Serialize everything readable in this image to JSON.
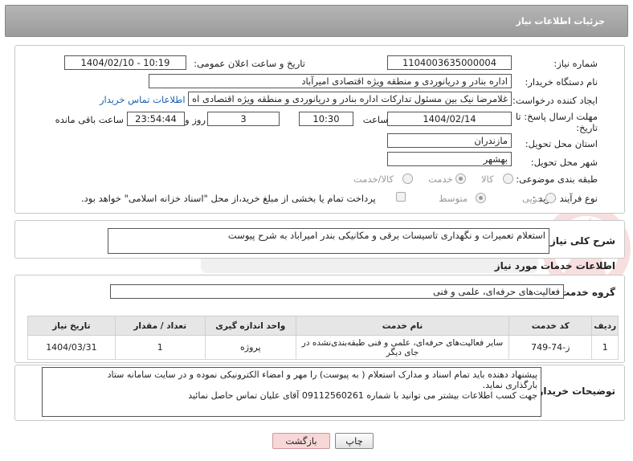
{
  "header": {
    "title": "جزئیات اطلاعات نیاز"
  },
  "form": {
    "need_number_label": "شماره نیاز:",
    "need_number": "1104003635000004",
    "announce_label": "تاریخ و ساعت اعلان عمومی:",
    "announce_value": "1404/02/10 - 10:19",
    "buyer_org_label": "نام دستگاه خریدار:",
    "buyer_org": "اداره بنادر و دریانوردی و منطقه ویژه اقتصادی امیرآباد",
    "creator_label": "ایجاد کننده درخواست:",
    "creator": "غلامرضا نیک بین مسئول تدارکات اداره بنادر و دریانوردی و منطقه ویژه اقتصادی اه",
    "contact_link": "اطلاعات تماس خریدار",
    "deadline_label_1": "مهلت ارسال پاسخ: تا",
    "deadline_label_2": "تاریخ:",
    "deadline_date": "1404/02/14",
    "time_label": "ساعت",
    "deadline_time": "10:30",
    "days_value": "3",
    "days_label": "روز و",
    "remaining_time": "23:54:44",
    "remaining_label": "ساعت باقی مانده",
    "province_label": "استان محل تحویل:",
    "province": "مازندران",
    "city_label": "شهر محل تحویل:",
    "city": "بهشهر",
    "category_label": "طبقه بندی موضوعی:",
    "category_options": [
      "کالا",
      "خدمت",
      "کالا/خدمت"
    ],
    "category_selected": "خدمت",
    "process_label": "نوع فرآیند خرید :",
    "process_options": [
      "جزیی",
      "متوسط"
    ],
    "process_selected": "متوسط",
    "payment_note": "پرداخت تمام یا بخشی از مبلغ خرید،از محل \"اسناد خزانه اسلامی\" خواهد بود."
  },
  "summary": {
    "label": "شرح کلی نیاز:",
    "text": "استعلام تعمیرات و نگهداری تاسیسات برقی و مکانیکی بندر امیراباد به شرح پیوست"
  },
  "services": {
    "section_title": "اطلاعات خدمات مورد نیاز",
    "group_label": "گروه خدمت:",
    "group_value": "فعالیت‌های حرفه‌ای، علمی و فنی",
    "columns": [
      "ردیف",
      "کد خدمت",
      "نام خدمت",
      "واحد اندازه گیری",
      "تعداد / مقدار",
      "تاریخ نیاز"
    ],
    "rows": [
      {
        "row": "1",
        "code": "ز-74-749",
        "name": "سایر فعالیت‌های حرفه‌ای، علمی و فنی طبقه‌بندی‌نشده در جای دیگر",
        "unit": "پروژه",
        "qty": "1",
        "date": "1404/03/31"
      }
    ]
  },
  "buyer_notes": {
    "label": "توضیحات خریدار:",
    "line1": "پیشنهاد دهنده باید تمام اسناد و مدارک استعلام ( به پیوست) را مهر و امضاء الکترونیکی نموده و در سایت سامانه ستاد",
    "line2": "بارگذاری نماید.",
    "line3": "جهت کسب اطلاعات بیشتر می توانید با شماره 09112560261 آقای علیان تماس حاصل نمائید"
  },
  "buttons": {
    "print": "چاپ",
    "back": "بازگشت"
  },
  "colors": {
    "header_gray": "#a8a8a8",
    "link_blue": "#1a5fb4",
    "back_button_bg": "#f7d7d7"
  }
}
